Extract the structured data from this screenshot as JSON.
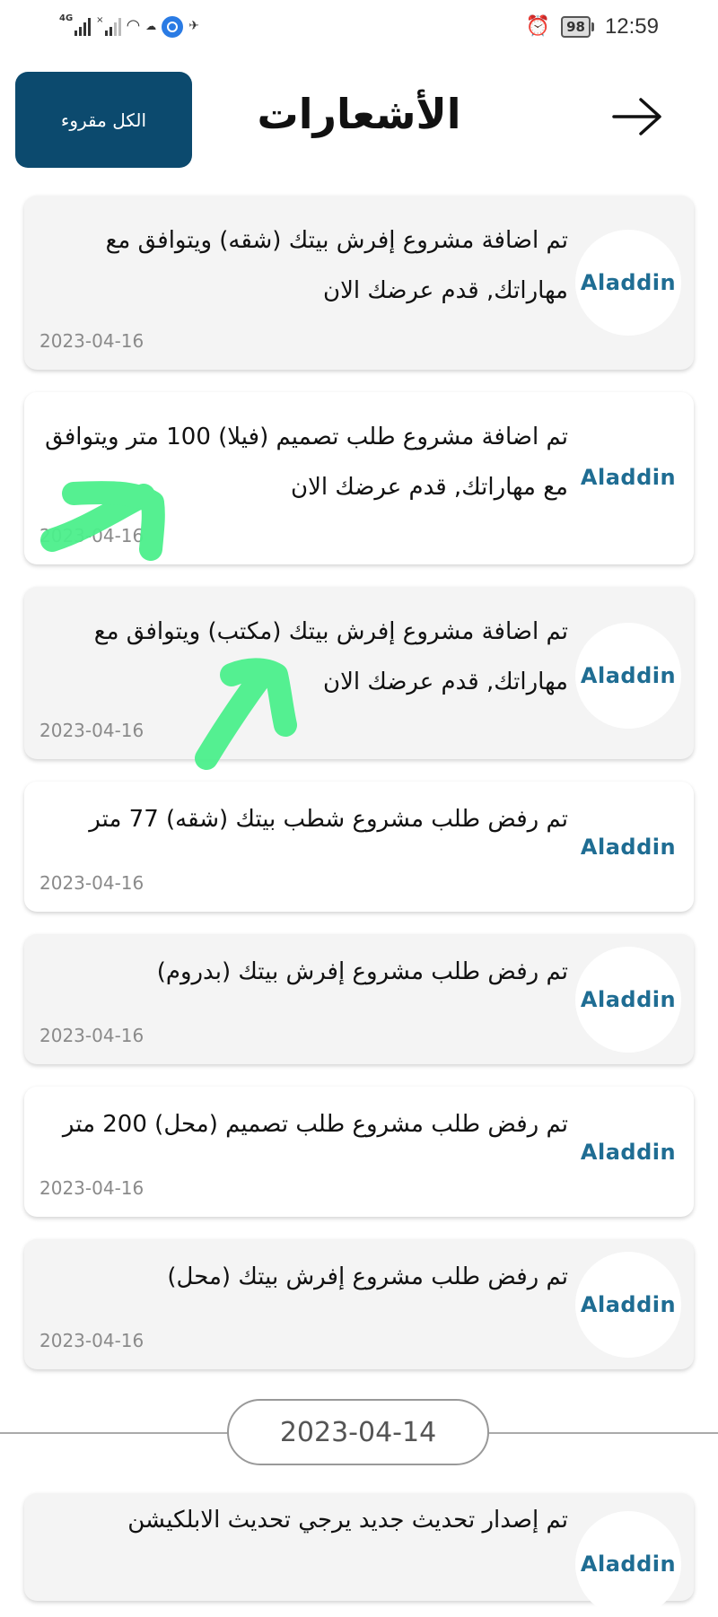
{
  "status_bar": {
    "network": "4G",
    "battery": "98",
    "time": "12:59"
  },
  "header": {
    "title": "الأشعارات",
    "mark_all_read": "الكل مقروء",
    "back_icon": "arrow-right-icon"
  },
  "notifications": [
    {
      "logo": "Aladdin",
      "text": "تم اضافة مشروع إفرش بيتك (شقه)  ويتوافق مع مهاراتك, قدم عرضك الان",
      "date": "2023-04-16",
      "read": false
    },
    {
      "logo": "Aladdin",
      "text": "تم اضافة مشروع طلب تصميم (فيلا) 100 متر ويتوافق مع مهاراتك, قدم عرضك الان",
      "date": "2023-04-16",
      "read": true
    },
    {
      "logo": "Aladdin",
      "text": "تم اضافة مشروع إفرش بيتك (مكتب)  ويتوافق مع مهاراتك, قدم عرضك الان",
      "date": "2023-04-16",
      "read": false
    },
    {
      "logo": "Aladdin",
      "text": "تم رفض طلب مشروع شطب بيتك (شقه) 77 متر",
      "date": "2023-04-16",
      "read": true
    },
    {
      "logo": "Aladdin",
      "text": "تم رفض طلب مشروع إفرش بيتك (بدروم)",
      "date": "2023-04-16",
      "read": false
    },
    {
      "logo": "Aladdin",
      "text": "تم رفض طلب مشروع طلب تصميم (محل) 200 متر",
      "date": "2023-04-16",
      "read": true
    },
    {
      "logo": "Aladdin",
      "text": "تم رفض طلب مشروع إفرش بيتك (محل)",
      "date": "2023-04-16",
      "read": false
    }
  ],
  "date_separator": "2023-04-14",
  "next_notification": {
    "logo": "Aladdin",
    "text": "تم إصدار تحديث جديد يرجي تحديث الابلكيشن"
  },
  "colors": {
    "button": "#0c4a6e",
    "logo": "#1f6d93",
    "annotation": "#4cf08c"
  }
}
